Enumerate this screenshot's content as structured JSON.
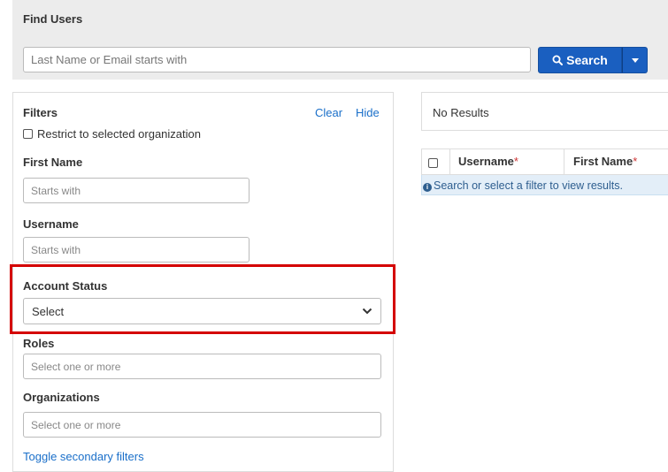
{
  "header": {
    "title": "Find Users",
    "search_placeholder": "Last Name or Email starts with",
    "search_button": "Search"
  },
  "filters": {
    "title": "Filters",
    "clear": "Clear",
    "hide": "Hide",
    "restrict_label": "Restrict to selected organization",
    "first_name_label": "First Name",
    "first_name_placeholder": "Starts with",
    "username_label": "Username",
    "username_placeholder": "Starts with",
    "account_status_label": "Account Status",
    "account_status_value": "Select",
    "roles_label": "Roles",
    "roles_placeholder": "Select one or more",
    "organizations_label": "Organizations",
    "organizations_placeholder": "Select one or more",
    "toggle_secondary": "Toggle secondary filters"
  },
  "results": {
    "status": "No Results",
    "columns": [
      "Username",
      "First Name"
    ],
    "required_marker": "*",
    "empty_message": "Search or select a filter to view results."
  },
  "colors": {
    "primary_button": "#1a5fc0",
    "link": "#1a6fc9",
    "highlight": "#d40000",
    "info_bg": "#e3eef8"
  }
}
